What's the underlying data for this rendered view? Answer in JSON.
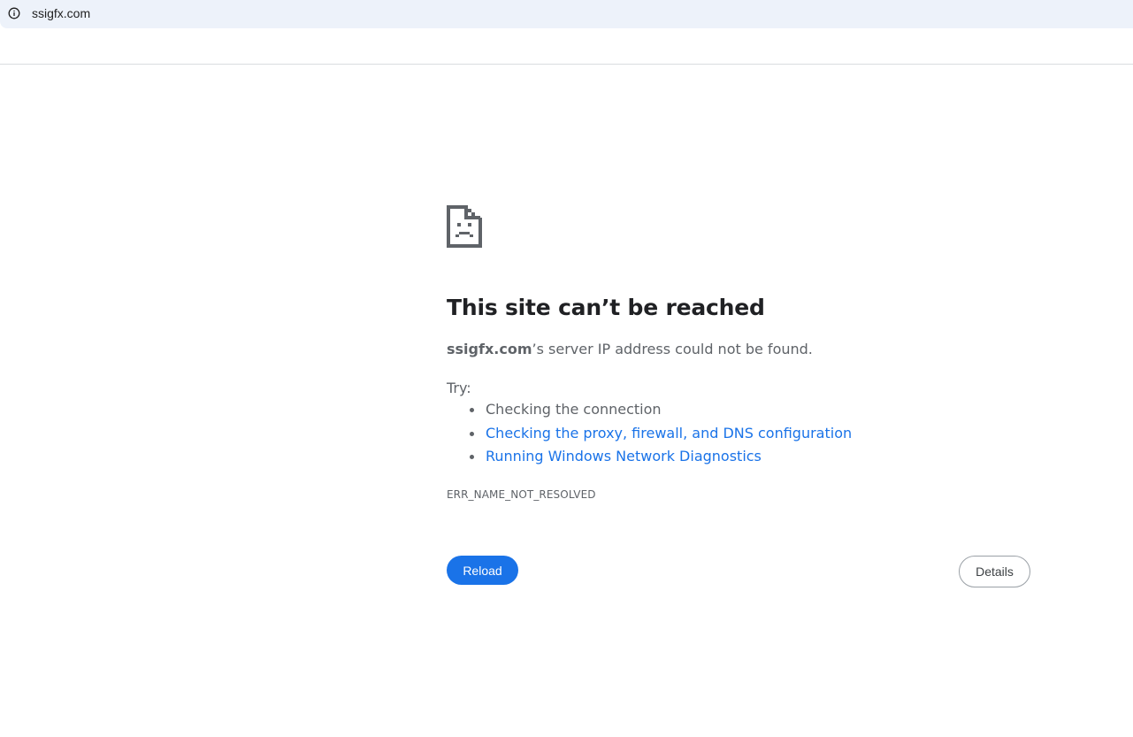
{
  "address_bar": {
    "url": "ssigfx.com",
    "icon": "info-icon"
  },
  "error_page": {
    "icon": "sad-document-icon",
    "heading": "This site can’t be reached",
    "summary_host": "ssigfx.com",
    "summary_rest": "’s server IP address could not be found.",
    "try_label": "Try:",
    "suggestions": [
      {
        "label": "Checking the connection",
        "is_link": false
      },
      {
        "label": "Checking the proxy, firewall, and DNS configuration",
        "is_link": true
      },
      {
        "label": "Running Windows Network Diagnostics",
        "is_link": true
      }
    ],
    "error_code": "ERR_NAME_NOT_RESOLVED",
    "reload_label": "Reload",
    "details_label": "Details"
  },
  "colors": {
    "link": "#1a73e8",
    "primary_button": "#1a73e8",
    "text_secondary": "#5f6368",
    "heading": "#202124",
    "address_bar_bg": "#edf2fa"
  }
}
